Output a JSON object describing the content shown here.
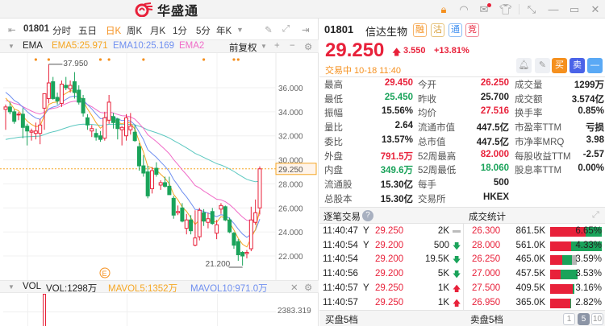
{
  "app": {
    "logo_text": "华盛通"
  },
  "toolbar": {
    "code": "01801",
    "tabs": [
      "分时",
      "五日",
      "日K",
      "周K",
      "月K",
      "1分",
      "5分",
      "年K"
    ],
    "active": "日K"
  },
  "indicator": {
    "name": "EMA",
    "ema5": "EMA5:25.971",
    "ema10": "EMA10:25.169",
    "ema20": "EMA2",
    "adjust": "前复权"
  },
  "volume": {
    "name": "VOL",
    "vol": "VOL:1298万",
    "mavol5": "MAVOL5:1352万",
    "mavol10": "MAVOL10:971.0万",
    "axis_label": "2383.319"
  },
  "quote": {
    "code": "01801",
    "name": "信达生物",
    "tags": [
      "融",
      "沽",
      "通",
      "竞"
    ],
    "price": "29.250",
    "change": "3.550",
    "change_pct": "+13.81%",
    "status": "交易中 10-18 11:40",
    "buy": "买",
    "sell": "卖",
    "minus": "—"
  },
  "stats": [
    [
      {
        "l": "最高",
        "v": "29.450",
        "c": "red"
      },
      {
        "l": "今开",
        "v": "26.250",
        "c": "red"
      },
      {
        "l": "成交量",
        "v": "1299万"
      }
    ],
    [
      {
        "l": "最低",
        "v": "25.450",
        "c": "green"
      },
      {
        "l": "昨收",
        "v": "25.700"
      },
      {
        "l": "成交额",
        "v": "3.574亿"
      }
    ],
    [
      {
        "l": "振幅",
        "v": "15.56%"
      },
      {
        "l": "均价",
        "v": "27.516",
        "c": "red"
      },
      {
        "l": "换手率",
        "v": "0.85%"
      }
    ],
    [
      {
        "l": "量比",
        "v": "2.64"
      },
      {
        "l": "流通市值",
        "v": "447.5亿"
      },
      {
        "l": "市盈率TTM",
        "v": "亏损"
      }
    ],
    [
      {
        "l": "委比",
        "v": "13.57%"
      },
      {
        "l": "总市值",
        "v": "447.5亿"
      },
      {
        "l": "市净率MRQ",
        "v": "3.98"
      }
    ],
    [
      {
        "l": "外盘",
        "v": "791.5万",
        "c": "red"
      },
      {
        "l": "52周最高",
        "v": "82.000",
        "c": "red"
      },
      {
        "l": "每股收益TTM",
        "v": "-2.57"
      }
    ],
    [
      {
        "l": "内盘",
        "v": "349.6万",
        "c": "green"
      },
      {
        "l": "52周最低",
        "v": "18.060",
        "c": "green"
      },
      {
        "l": "股息率TTM",
        "v": "0.00%"
      }
    ],
    [
      {
        "l": "流通股",
        "v": "15.30亿"
      },
      {
        "l": "每手",
        "v": "500"
      }
    ],
    [
      {
        "l": "总股本",
        "v": "15.30亿"
      },
      {
        "l": "交易所",
        "v": "HKEX"
      }
    ]
  ],
  "trades": {
    "title": "逐笔交易",
    "rows": [
      {
        "t": "11:40:47",
        "f": "Y",
        "p": "29.250",
        "v": "2K",
        "d": "flat"
      },
      {
        "t": "11:40:54",
        "f": "Y",
        "p": "29.200",
        "v": "500",
        "d": "down"
      },
      {
        "t": "11:40:54",
        "f": "",
        "p": "29.200",
        "v": "19.5K",
        "d": "down"
      },
      {
        "t": "11:40:56",
        "f": "",
        "p": "29.200",
        "v": "5K",
        "d": "down"
      },
      {
        "t": "11:40:57",
        "f": "Y",
        "p": "29.250",
        "v": "1K",
        "d": "up"
      },
      {
        "t": "11:40:57",
        "f": "",
        "p": "29.250",
        "v": "1K",
        "d": "up"
      }
    ]
  },
  "volstats": {
    "title": "成交统计",
    "rows": [
      {
        "p": "26.300",
        "v": "861.5K",
        "pct": "6.65%",
        "bar": [
          0.68,
          0.32,
          0
        ]
      },
      {
        "p": "28.000",
        "v": "561.0K",
        "pct": "4.33%",
        "bar": [
          0.41,
          0.59,
          0
        ]
      },
      {
        "p": "26.250",
        "v": "465.0K",
        "pct": "3.59%",
        "bar": [
          0.24,
          0.18,
          0.09
        ]
      },
      {
        "p": "27.000",
        "v": "457.5K",
        "pct": "3.53%",
        "bar": [
          0.2,
          0.33,
          0
        ]
      },
      {
        "p": "27.500",
        "v": "409.5K",
        "pct": "3.16%",
        "bar": [
          0.44,
          0.03,
          0
        ]
      },
      {
        "p": "26.950",
        "v": "365.0K",
        "pct": "2.82%",
        "bar": [
          0.39,
          0.02,
          0
        ]
      }
    ]
  },
  "footer": {
    "bid": "买盘5档",
    "ask": "卖盘5档",
    "pages": [
      "1",
      "5",
      "10"
    ],
    "active_page": "5"
  },
  "chart_data": {
    "type": "candlestick",
    "ylim": [
      20.5,
      38.2
    ],
    "yticks": [
      "36.000",
      "34.000",
      "32.000",
      "30.000",
      "28.000",
      "26.000",
      "24.000",
      "22.000"
    ],
    "last_price": "29.250",
    "high_label": "37.950",
    "low_label": "21.200",
    "colors": {
      "up": "#e8213a",
      "down": "#1aa35a",
      "ema5": "#f5a623",
      "ema10": "#6f8ff0",
      "ema20": "#f06cc8",
      "ema60": "#5cc8c0"
    },
    "ema_seeds": {
      "ema5": 35.5,
      "ema10": 35.9,
      "ema20": 35.0,
      "ema60": 31.6
    },
    "event_marker": "E",
    "dividend_dots": [
      7,
      10,
      22,
      24,
      32,
      46,
      53,
      54
    ],
    "candles": [
      [
        34.2,
        34.6,
        32.5,
        34.4
      ],
      [
        34.4,
        34.8,
        33.8,
        34.0
      ],
      [
        34.0,
        34.2,
        33.0,
        33.2
      ],
      [
        33.8,
        34.0,
        33.3,
        33.8
      ],
      [
        33.8,
        34.3,
        31.8,
        32.7
      ],
      [
        32.8,
        33.0,
        31.2,
        32.4
      ],
      [
        32.3,
        32.6,
        31.6,
        32.4
      ],
      [
        32.2,
        33.1,
        31.7,
        32.4
      ],
      [
        32.2,
        33.4,
        31.3,
        32.9
      ],
      [
        34.3,
        35.3,
        32.5,
        35.5
      ],
      [
        35.1,
        37.95,
        34.7,
        36.4
      ],
      [
        36.5,
        36.9,
        35.0,
        35.1
      ],
      [
        35.2,
        35.6,
        34.6,
        34.9
      ],
      [
        34.7,
        36.6,
        34.4,
        36.3
      ],
      [
        36.2,
        36.9,
        35.8,
        36.0
      ],
      [
        35.9,
        36.6,
        35.6,
        36.2
      ],
      [
        36.5,
        37.3,
        35.1,
        35.6
      ],
      [
        35.8,
        36.2,
        34.6,
        34.8
      ],
      [
        35.1,
        35.4,
        33.6,
        33.9
      ],
      [
        33.5,
        33.8,
        32.5,
        32.9
      ],
      [
        32.4,
        32.9,
        31.9,
        32.6
      ],
      [
        32.2,
        32.6,
        31.6,
        31.9
      ],
      [
        32.0,
        32.4,
        31.5,
        31.7
      ],
      [
        31.8,
        34.0,
        31.6,
        33.5
      ],
      [
        33.3,
        35.4,
        33.0,
        34.8
      ],
      [
        33.6,
        33.9,
        32.6,
        33.1
      ],
      [
        33.4,
        33.5,
        31.7,
        32.6
      ],
      [
        32.5,
        32.8,
        31.2,
        32.7
      ],
      [
        32.0,
        33.8,
        31.6,
        33.5
      ],
      [
        32.5,
        33.9,
        32.1,
        32.8
      ],
      [
        32.3,
        32.9,
        31.5,
        31.6
      ],
      [
        31.1,
        31.4,
        29.1,
        29.5
      ],
      [
        29.5,
        30.4,
        28.6,
        28.9
      ],
      [
        29.0,
        29.5,
        26.8,
        27.0
      ],
      [
        27.6,
        29.4,
        27.2,
        29.1
      ],
      [
        29.3,
        29.8,
        28.6,
        28.8
      ],
      [
        27.9,
        28.3,
        27.5,
        28.1
      ],
      [
        28.1,
        28.6,
        27.7,
        27.8
      ],
      [
        27.8,
        28.6,
        27.1,
        27.1
      ],
      [
        26.8,
        27.0,
        25.1,
        25.4
      ],
      [
        25.6,
        26.2,
        25.4,
        25.7
      ],
      [
        26.0,
        26.4,
        24.8,
        24.9
      ],
      [
        24.3,
        25.5,
        23.8,
        25.0
      ],
      [
        25.0,
        25.4,
        23.8,
        24.1
      ],
      [
        22.9,
        25.8,
        22.8,
        23.5
      ],
      [
        23.6,
        26.0,
        23.3,
        25.8
      ],
      [
        25.6,
        25.9,
        24.5,
        24.9
      ],
      [
        24.8,
        25.6,
        24.3,
        25.1
      ],
      [
        25.7,
        26.0,
        24.6,
        24.7
      ],
      [
        23.9,
        25.0,
        23.4,
        24.6
      ],
      [
        25.9,
        26.4,
        25.5,
        26.2
      ],
      [
        26.1,
        26.2,
        24.9,
        25.0
      ],
      [
        25.0,
        25.2,
        23.9,
        24.0
      ],
      [
        23.9,
        24.0,
        22.6,
        22.9
      ],
      [
        23.2,
        23.4,
        21.6,
        22.1
      ],
      [
        22.3,
        22.4,
        21.2,
        22.0
      ],
      [
        22.2,
        22.5,
        21.8,
        22.3
      ],
      [
        22.6,
        26.1,
        22.4,
        25.0
      ],
      [
        24.8,
        26.7,
        24.6,
        25.6
      ],
      [
        26.0,
        29.45,
        25.45,
        29.25
      ]
    ]
  }
}
